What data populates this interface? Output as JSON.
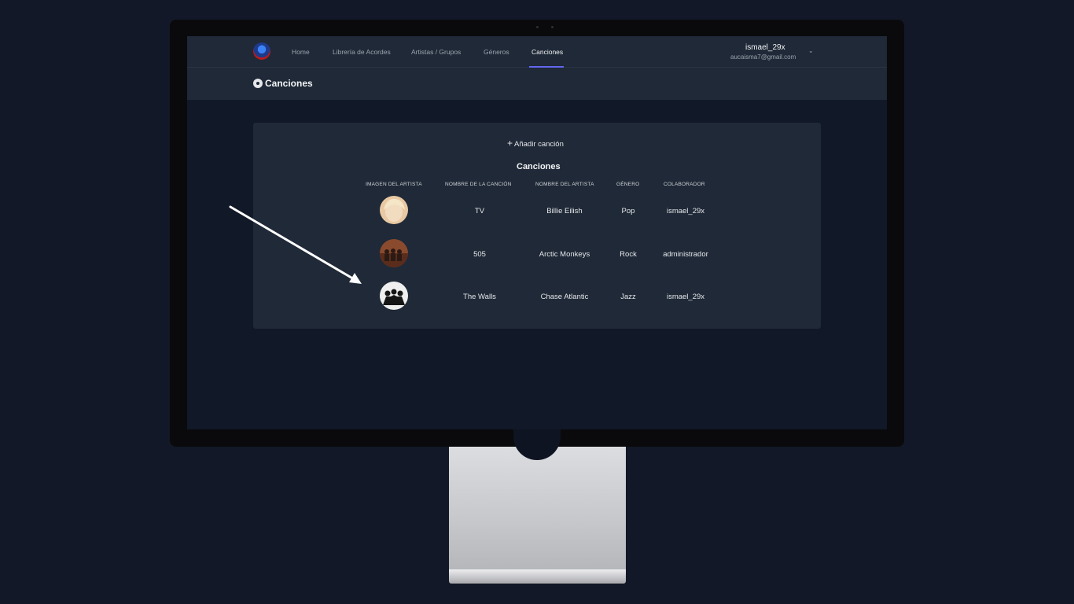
{
  "navbar": {
    "items": [
      {
        "label": "Home"
      },
      {
        "label": "Librería de Acordes"
      },
      {
        "label": "Artistas / Grupos"
      },
      {
        "label": "Géneros"
      },
      {
        "label": "Canciones"
      }
    ],
    "active": "Canciones",
    "user": {
      "name": "ismael_29x",
      "email": "aucaisma7@gmail.com"
    }
  },
  "page": {
    "title": "Canciones"
  },
  "card": {
    "add_label": "Añadir canción",
    "table_title": "Canciones",
    "columns": [
      "IMAGEN DEL ARTISTA",
      "NOMBRE DE LA CANCIÓN",
      "NOMBRE DEL ARTISTA",
      "GÉNERO",
      "COLABORADOR"
    ],
    "rows": [
      {
        "song": "TV",
        "artist": "Billie Eilish",
        "genre": "Pop",
        "collaborator": "ismael_29x"
      },
      {
        "song": "505",
        "artist": "Arctic Monkeys",
        "genre": "Rock",
        "collaborator": "administrador"
      },
      {
        "song": "The Walls",
        "artist": "Chase Atlantic",
        "genre": "Jazz",
        "collaborator": "ismael_29x"
      }
    ]
  },
  "colors": {
    "accent": "#6366f1",
    "background": "#121827",
    "panel": "#1f2937"
  }
}
